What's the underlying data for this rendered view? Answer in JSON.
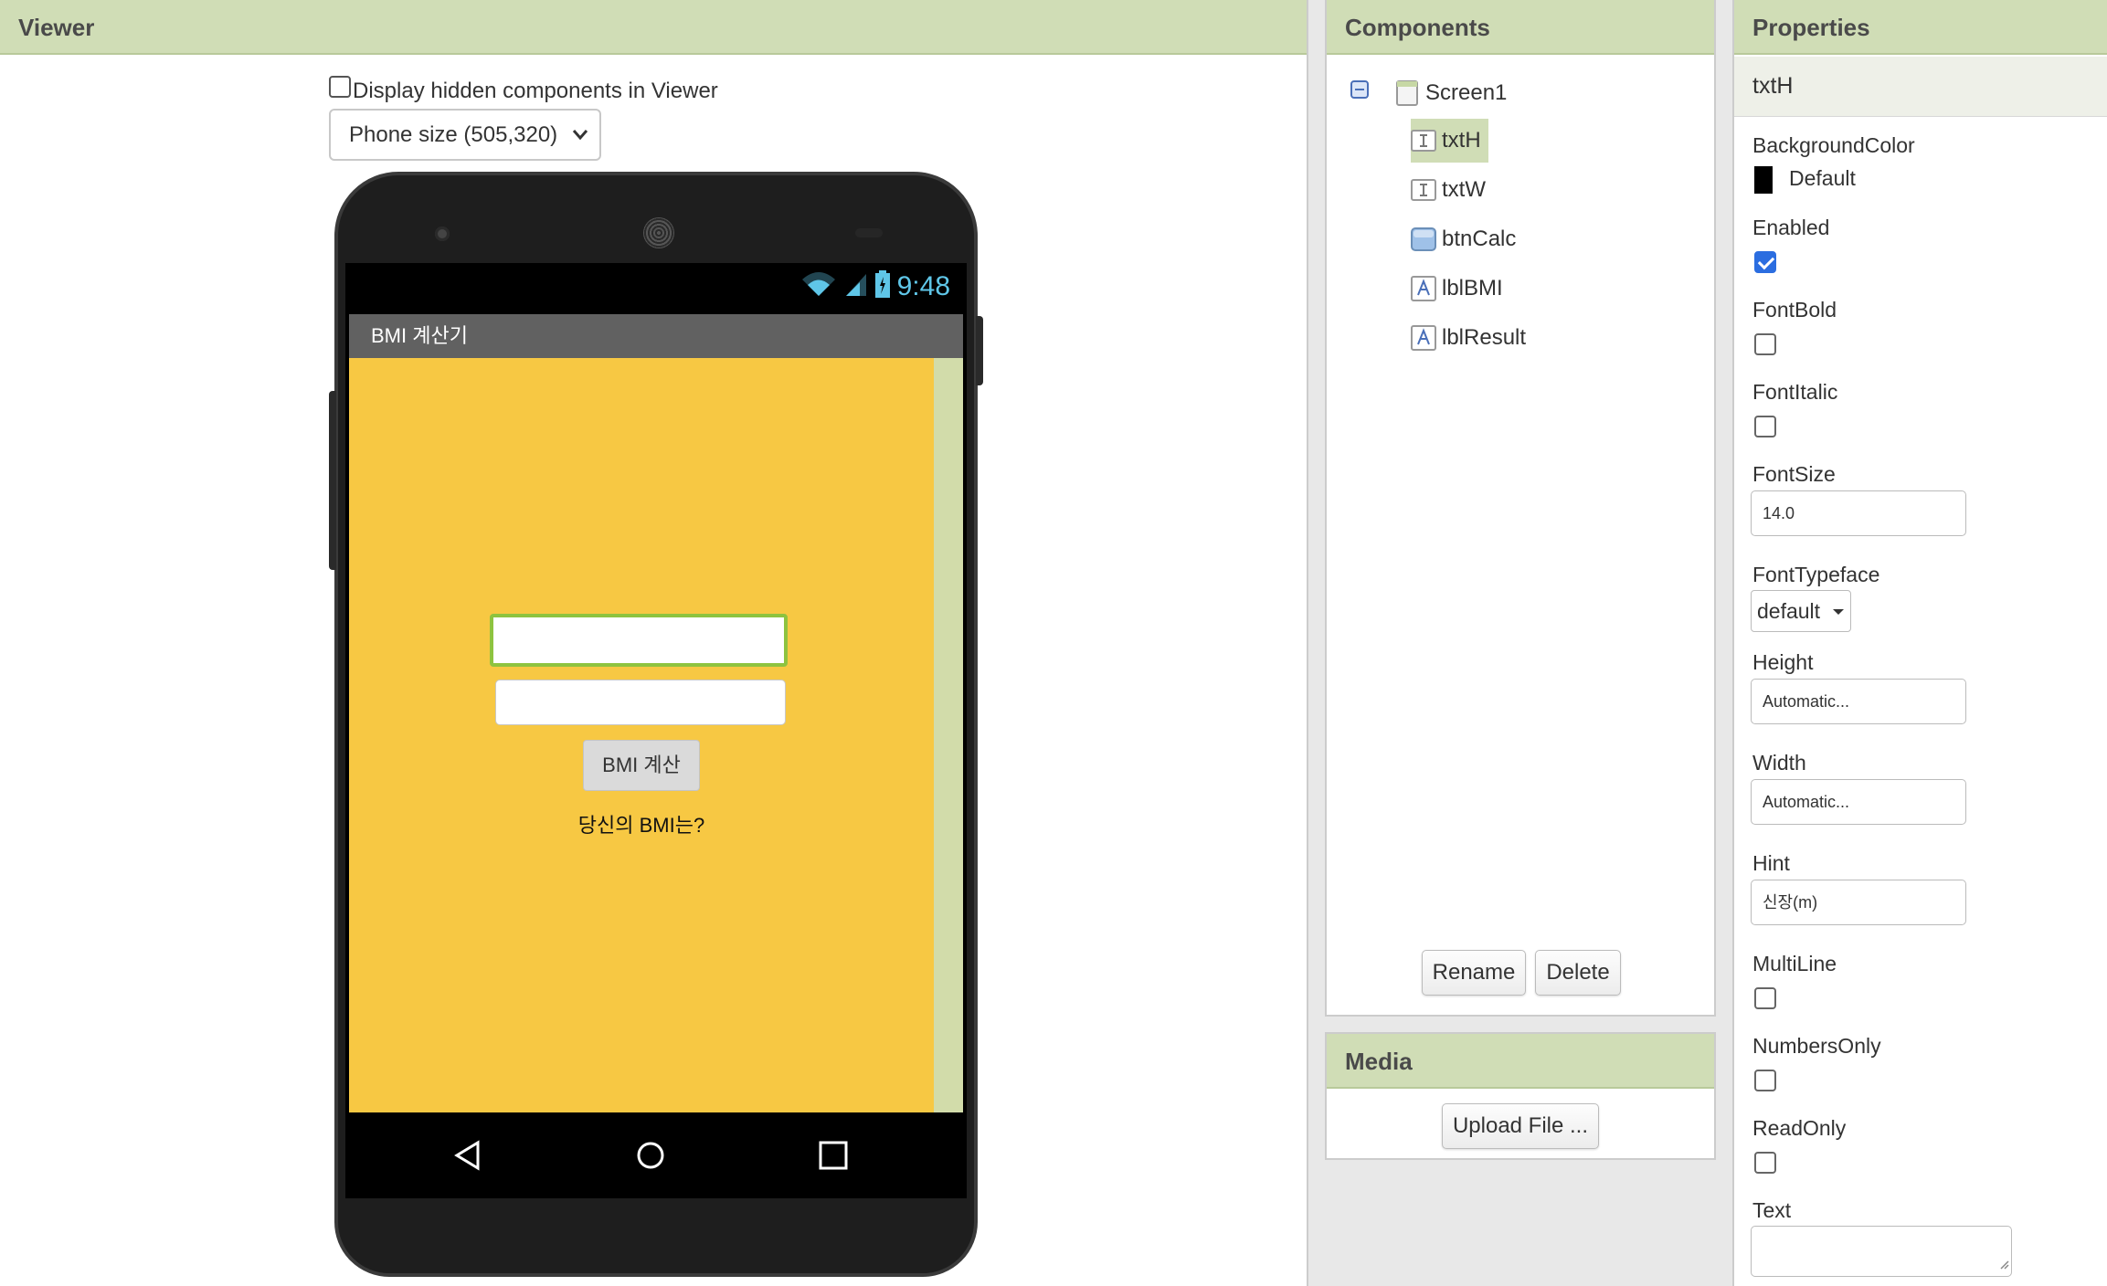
{
  "viewer": {
    "title": "Viewer",
    "hidden_checkbox_label": "Display hidden components in Viewer",
    "size_select_value": "Phone size (505,320)"
  },
  "phone": {
    "status_time": "9:48",
    "app_title": "BMI 계산기",
    "button_label": "BMI 계산",
    "result_label": "당신의 BMI는?"
  },
  "components": {
    "title": "Components",
    "tree": [
      {
        "label": "Screen1",
        "icon": "screen-icon"
      },
      {
        "label": "txtH",
        "icon": "textbox-icon",
        "selected": true
      },
      {
        "label": "txtW",
        "icon": "textbox-icon"
      },
      {
        "label": "btnCalc",
        "icon": "button-icon"
      },
      {
        "label": "lblBMI",
        "icon": "label-icon"
      },
      {
        "label": "lblResult",
        "icon": "label-icon"
      }
    ],
    "rename_label": "Rename",
    "delete_label": "Delete"
  },
  "media": {
    "title": "Media",
    "upload_label": "Upload File ..."
  },
  "properties": {
    "title": "Properties",
    "component_name": "txtH",
    "background_color_label": "BackgroundColor",
    "background_color_value": "Default",
    "enabled_label": "Enabled",
    "enabled": true,
    "fontbold_label": "FontBold",
    "fontitalic_label": "FontItalic",
    "fontsize_label": "FontSize",
    "fontsize_value": "14.0",
    "fonttypeface_label": "FontTypeface",
    "fonttypeface_value": "default",
    "height_label": "Height",
    "height_value": "Automatic...",
    "width_label": "Width",
    "width_value": "Automatic...",
    "hint_label": "Hint",
    "hint_value": "신장(m)",
    "multiline_label": "MultiLine",
    "numbersonly_label": "NumbersOnly",
    "readonly_label": "ReadOnly",
    "text_label": "Text",
    "text_value": ""
  },
  "colors": {
    "header_bg": "#d0ddb6",
    "canvas_bg": "#f7c843",
    "selected_border": "#8ec33f",
    "checkbox_checked": "#2b6de0"
  }
}
